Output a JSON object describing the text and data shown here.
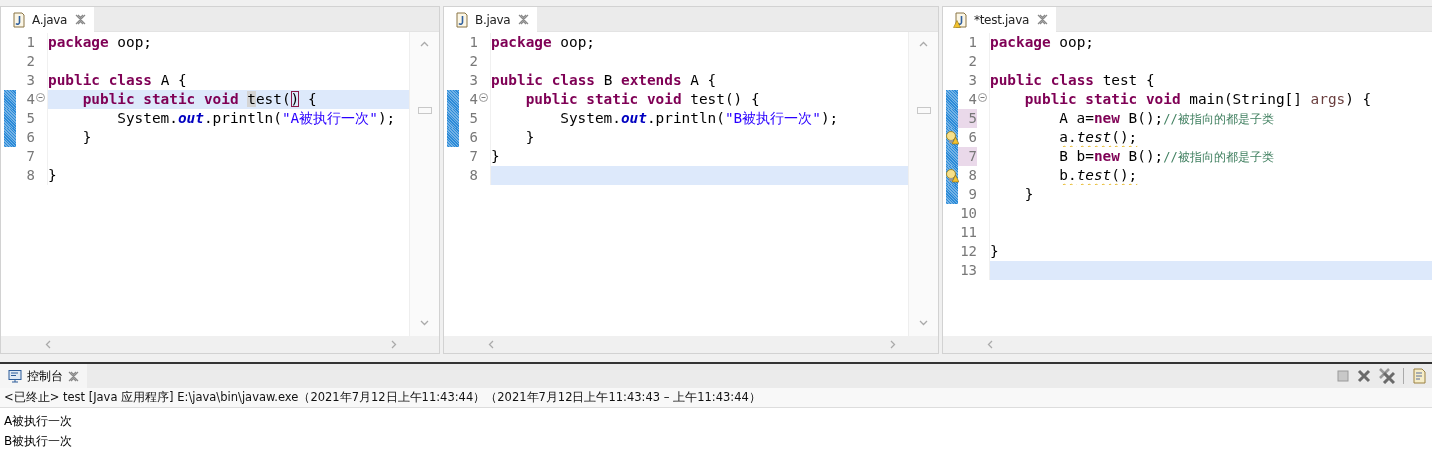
{
  "editors": [
    {
      "tab": {
        "label": "A.java",
        "warning": false
      },
      "vertical_scrollbar": true,
      "lines": [
        {
          "n": "1",
          "kind": "top",
          "current": false,
          "changed": false,
          "warning": false,
          "marked": false,
          "fold": false,
          "tokens": [
            {
              "kind": "kw",
              "text": "package"
            },
            {
              "kind": "text",
              "text": " oop;"
            }
          ]
        },
        {
          "n": "2",
          "kind": "top",
          "current": false,
          "changed": false,
          "warning": false,
          "marked": false,
          "fold": false
        },
        {
          "n": "3",
          "kind": "top",
          "current": false,
          "changed": false,
          "warning": false,
          "marked": false,
          "fold": false,
          "tokens": [
            {
              "kind": "kw",
              "text": "public class"
            },
            {
              "kind": "text",
              "text": " A {"
            }
          ]
        },
        {
          "n": "4",
          "kind": "member",
          "current": true,
          "changed": true,
          "warning": false,
          "marked": false,
          "fold": true,
          "tokens": [
            {
              "kind": "kw",
              "text": "public static void "
            },
            {
              "kind": "occurrence",
              "text": "t"
            },
            {
              "kind": "text",
              "text": "est("
            },
            {
              "kind": "bracket",
              "text": ")"
            },
            {
              "kind": "text",
              "text": " {"
            }
          ]
        },
        {
          "n": "5",
          "kind": "body",
          "current": false,
          "changed": true,
          "warning": false,
          "marked": false,
          "fold": false,
          "tokens": [
            {
              "kind": "text",
              "text": "System."
            },
            {
              "kind": "field",
              "text": "out"
            },
            {
              "kind": "text",
              "text": ".println("
            },
            {
              "kind": "string",
              "text": "\"A被执行一次\""
            },
            {
              "kind": "text",
              "text": ");"
            }
          ]
        },
        {
          "n": "6",
          "kind": "member",
          "current": false,
          "changed": true,
          "warning": false,
          "marked": false,
          "fold": false,
          "tokens": [
            {
              "kind": "text",
              "text": "}"
            }
          ]
        },
        {
          "n": "7",
          "kind": "top",
          "current": false,
          "changed": false,
          "warning": false,
          "marked": false,
          "fold": false
        },
        {
          "n": "8",
          "kind": "top",
          "current": false,
          "changed": false,
          "warning": false,
          "marked": false,
          "fold": false,
          "tokens": [
            {
              "kind": "text",
              "text": "}"
            }
          ]
        }
      ]
    },
    {
      "tab": {
        "label": "B.java",
        "warning": false
      },
      "vertical_scrollbar": true,
      "lines": [
        {
          "n": "1",
          "kind": "top",
          "current": false,
          "changed": false,
          "warning": false,
          "marked": false,
          "fold": false,
          "tokens": [
            {
              "kind": "kw",
              "text": "package"
            },
            {
              "kind": "text",
              "text": " oop;"
            }
          ]
        },
        {
          "n": "2",
          "kind": "top",
          "current": false,
          "changed": false,
          "warning": false,
          "marked": false,
          "fold": false
        },
        {
          "n": "3",
          "kind": "top",
          "current": false,
          "changed": false,
          "warning": false,
          "marked": false,
          "fold": false,
          "tokens": [
            {
              "kind": "kw",
              "text": "public class"
            },
            {
              "kind": "text",
              "text": " B "
            },
            {
              "kind": "kw",
              "text": "extends"
            },
            {
              "kind": "text",
              "text": " A {"
            }
          ]
        },
        {
          "n": "4",
          "kind": "member",
          "current": false,
          "changed": true,
          "warning": false,
          "marked": false,
          "fold": true,
          "tokens": [
            {
              "kind": "kw",
              "text": "public static void"
            },
            {
              "kind": "text",
              "text": " test() {"
            }
          ]
        },
        {
          "n": "5",
          "kind": "body",
          "current": false,
          "changed": true,
          "warning": false,
          "marked": false,
          "fold": false,
          "tokens": [
            {
              "kind": "text",
              "text": "System."
            },
            {
              "kind": "field",
              "text": "out"
            },
            {
              "kind": "text",
              "text": ".println("
            },
            {
              "kind": "string",
              "text": "\"B被执行一次\""
            },
            {
              "kind": "text",
              "text": ");"
            }
          ]
        },
        {
          "n": "6",
          "kind": "member",
          "current": false,
          "changed": true,
          "warning": false,
          "marked": false,
          "fold": false,
          "tokens": [
            {
              "kind": "text",
              "text": "}"
            }
          ]
        },
        {
          "n": "7",
          "kind": "top",
          "current": false,
          "changed": false,
          "warning": false,
          "marked": false,
          "fold": false,
          "tokens": [
            {
              "kind": "text",
              "text": "}"
            }
          ]
        },
        {
          "n": "8",
          "kind": "top",
          "current": true,
          "changed": false,
          "warning": false,
          "marked": false,
          "fold": false
        }
      ]
    },
    {
      "tab": {
        "label": "*test.java",
        "warning": true
      },
      "vertical_scrollbar": false,
      "lines": [
        {
          "n": "1",
          "kind": "top",
          "current": false,
          "changed": false,
          "warning": false,
          "marked": false,
          "fold": false,
          "tokens": [
            {
              "kind": "kw",
              "text": "package"
            },
            {
              "kind": "text",
              "text": " oop;"
            }
          ]
        },
        {
          "n": "2",
          "kind": "top",
          "current": false,
          "changed": false,
          "warning": false,
          "marked": false,
          "fold": false
        },
        {
          "n": "3",
          "kind": "top",
          "current": false,
          "changed": false,
          "warning": false,
          "marked": false,
          "fold": false,
          "tokens": [
            {
              "kind": "kw",
              "text": "public class"
            },
            {
              "kind": "text",
              "text": " test {"
            }
          ]
        },
        {
          "n": "4",
          "kind": "member",
          "current": false,
          "changed": true,
          "warning": false,
          "marked": false,
          "fold": true,
          "tokens": [
            {
              "kind": "kw",
              "text": "public static void"
            },
            {
              "kind": "text",
              "text": " main(String[] "
            },
            {
              "kind": "param",
              "text": "args"
            },
            {
              "kind": "text",
              "text": ") {"
            }
          ]
        },
        {
          "n": "5",
          "kind": "body",
          "current": false,
          "changed": true,
          "warning": false,
          "marked": true,
          "fold": false,
          "tokens": [
            {
              "kind": "text",
              "text": "A a="
            },
            {
              "kind": "kw",
              "text": "new"
            },
            {
              "kind": "text",
              "text": " B();"
            },
            {
              "kind": "comment",
              "text": "//被指向的都是子类"
            }
          ]
        },
        {
          "n": "6",
          "kind": "body",
          "current": false,
          "changed": true,
          "warning": true,
          "marked": false,
          "fold": false,
          "tokens": [
            {
              "kind": "text",
              "text": "a."
            },
            {
              "kind": "static",
              "text": "test"
            },
            {
              "kind": "text",
              "text": "();"
            }
          ]
        },
        {
          "n": "7",
          "kind": "body",
          "current": false,
          "changed": true,
          "warning": false,
          "marked": true,
          "fold": false,
          "tokens": [
            {
              "kind": "text",
              "text": "B b="
            },
            {
              "kind": "kw",
              "text": "new"
            },
            {
              "kind": "text",
              "text": " B();"
            },
            {
              "kind": "comment",
              "text": "//被指向的都是子类"
            }
          ]
        },
        {
          "n": "8",
          "kind": "body",
          "current": false,
          "changed": true,
          "warning": true,
          "marked": false,
          "fold": false,
          "tokens": [
            {
              "kind": "text",
              "text": "b."
            },
            {
              "kind": "static",
              "text": "test"
            },
            {
              "kind": "text",
              "text": "();"
            }
          ]
        },
        {
          "n": "9",
          "kind": "member",
          "current": false,
          "changed": true,
          "warning": false,
          "marked": false,
          "fold": false,
          "tokens": [
            {
              "kind": "text",
              "text": "}"
            }
          ]
        },
        {
          "n": "10",
          "kind": "top",
          "current": false,
          "changed": false,
          "warning": false,
          "marked": false,
          "fold": false
        },
        {
          "n": "11",
          "kind": "top",
          "current": false,
          "changed": false,
          "warning": false,
          "marked": false,
          "fold": false
        },
        {
          "n": "12",
          "kind": "top",
          "current": false,
          "changed": false,
          "warning": false,
          "marked": false,
          "fold": false,
          "tokens": [
            {
              "kind": "text",
              "text": "}"
            }
          ]
        },
        {
          "n": "13",
          "kind": "top",
          "current": true,
          "changed": false,
          "warning": false,
          "marked": false,
          "fold": false
        }
      ]
    }
  ],
  "console": {
    "tab": "控制台",
    "status": "<已终止> test [Java 应用程序] E:\\java\\bin\\javaw.exe（2021年7月12日上午11:43:44）（2021年7月12日上午11:43:43 – 上午11:43:44）",
    "output": [
      "A被执行一次",
      "B被执行一次"
    ]
  }
}
